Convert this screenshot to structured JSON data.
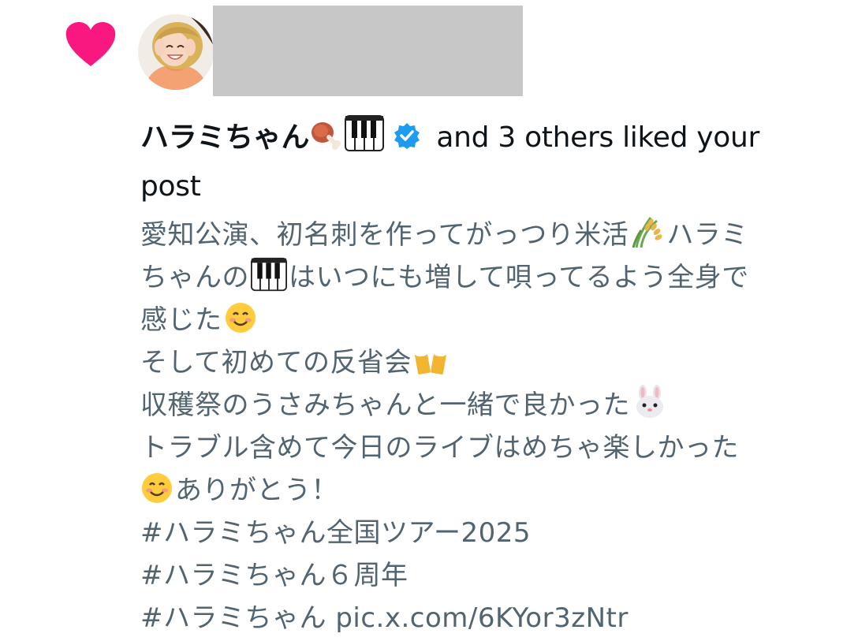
{
  "notification": {
    "type": "like",
    "heart_color": "#f91880",
    "username": "ハラミちゃん",
    "username_emojis": [
      "meat-on-bone-emoji",
      "piano-keys-emoji"
    ],
    "verified": true,
    "verified_color": "#1d9bf0",
    "action_text": "and 3 others liked your post",
    "action_text_line1": " and 3 others liked your",
    "action_text_line2": "post"
  },
  "post": {
    "lines": [
      {
        "text": "愛知公演、初名刺を作ってがっつり米活",
        "emoji_after": "rice-plant-emoji",
        "text2": "ハラミ"
      },
      {
        "text": "ちゃんの",
        "emoji_after": "piano-keys-emoji",
        "text2": "はいつにも増して唄ってるよう全身で"
      },
      {
        "text": "感じた",
        "emoji_after": "smiling-face-emoji",
        "text2": ""
      },
      {
        "text": "そして初めての反省会",
        "emoji_after": "beer-mugs-emoji",
        "text2": ""
      },
      {
        "text": "収穫祭のうさみちゃんと一緒で良かった",
        "emoji_after": "rabbit-face-emoji",
        "text2": ""
      },
      {
        "text": "トラブル含めて今日のライブはめちゃ楽しかった",
        "emoji_after": "",
        "text2": ""
      },
      {
        "text": "",
        "emoji_before": "smiling-face-emoji",
        "text2": "ありがとう！"
      }
    ],
    "hashtags": [
      "#ハラミちゃん全国ツアー2025",
      "#ハラミちゃん６周年",
      "#ハラミちゃん"
    ],
    "link": "pic.x.com/6KYor3zNtr"
  },
  "colors": {
    "text_primary": "#0f1419",
    "text_secondary": "#536471",
    "redaction": "#c7c7c7"
  }
}
